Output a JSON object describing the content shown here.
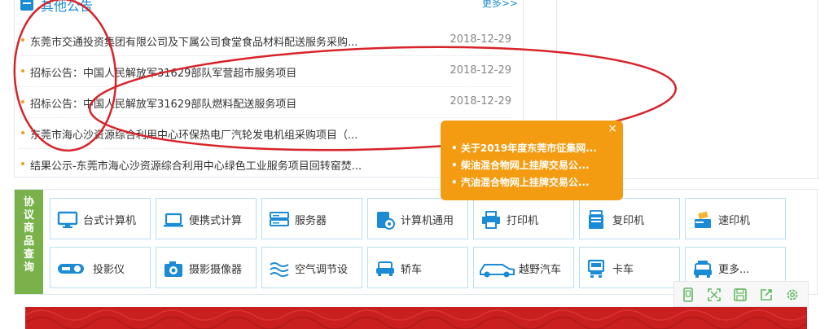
{
  "notice": {
    "title": "其他公告",
    "more": "更多>>",
    "items": [
      {
        "text": "东莞市交通投资集团有限公司及下属公司食堂食品材料配送服务采购...",
        "date": "2018-12-29"
      },
      {
        "text": "招标公告：中国人民解放军31629部队军营超市服务项目",
        "date": "2018-12-29"
      },
      {
        "text": "招标公告：中国人民解放军31629部队燃料配送服务项目",
        "date": "2018-12-29"
      },
      {
        "text": "东莞市海心沙资源综合利用中心环保热电厂汽轮发电机组采购项目（...",
        "date": ""
      },
      {
        "text": "结果公示-东莞市海心沙资源综合利用中心绿色工业服务项目回转窑焚...",
        "date": ""
      }
    ]
  },
  "categories": {
    "label_chars": [
      "协",
      "议",
      "商",
      "品",
      "查",
      "询"
    ],
    "items": [
      {
        "label": "台式计算机",
        "icon": "desktop-icon"
      },
      {
        "label": "便携式计算",
        "icon": "laptop-icon"
      },
      {
        "label": "服务器",
        "icon": "server-icon"
      },
      {
        "label": "计算机通用",
        "icon": "computer-general-icon"
      },
      {
        "label": "打印机",
        "icon": "printer-icon"
      },
      {
        "label": "复印机",
        "icon": "copier-icon"
      },
      {
        "label": "速印机",
        "icon": "duplicator-icon"
      },
      {
        "label": "投影仪",
        "icon": "projector-icon"
      },
      {
        "label": "摄影摄像器",
        "icon": "camera-icon"
      },
      {
        "label": "空气调节设",
        "icon": "air-conditioner-icon"
      },
      {
        "label": "轿车",
        "icon": "sedan-icon"
      },
      {
        "label": "越野汽车",
        "icon": "suv-icon"
      },
      {
        "label": "卡车",
        "icon": "truck-icon"
      },
      {
        "label": "更多...",
        "icon": "more-vehicle-icon"
      }
    ]
  },
  "popup": {
    "close": "×",
    "items": [
      "• 关于2019年度东莞市征集网...",
      "• 柴油混合物网上挂牌交易公...",
      "• 汽油混合物网上挂牌交易公..."
    ]
  },
  "toolbar": {
    "buttons": [
      "phone-view-icon",
      "fullscreen-icon",
      "save-icon",
      "share-icon",
      "settings-icon"
    ]
  },
  "colors": {
    "accent_blue": "#1b8bd5",
    "category_green": "#79b24a",
    "popup_orange": "#f39c12",
    "annotation_red": "#d8232a",
    "banner_red": "#c91f1f"
  }
}
